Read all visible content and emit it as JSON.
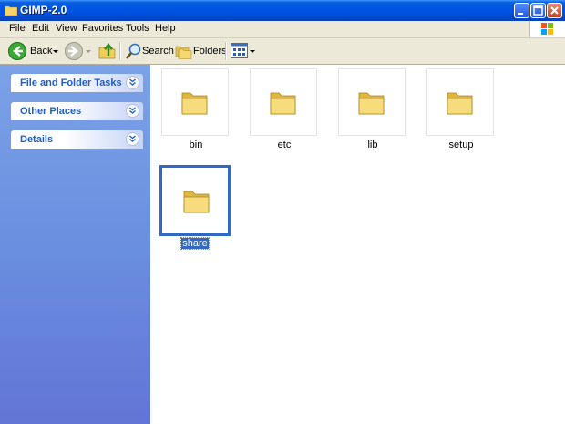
{
  "window": {
    "title": "GIMP-2.0"
  },
  "menu": [
    "File",
    "Edit",
    "View",
    "Favorites",
    "Tools",
    "Help"
  ],
  "toolbar": {
    "back_label": "Back",
    "search_label": "Search",
    "folders_label": "Folders"
  },
  "sidebar": {
    "panels": [
      {
        "title": "File and Folder Tasks"
      },
      {
        "title": "Other Places"
      },
      {
        "title": "Details"
      }
    ]
  },
  "folders": [
    {
      "name": "bin",
      "selected": false
    },
    {
      "name": "etc",
      "selected": false
    },
    {
      "name": "lib",
      "selected": false
    },
    {
      "name": "setup",
      "selected": false
    },
    {
      "name": "share",
      "selected": true
    }
  ],
  "colors": {
    "title_bar": "#0055e5",
    "sidebar": "#6a8fe0",
    "selection": "#316ac5",
    "panel_title": "#215dc6"
  }
}
